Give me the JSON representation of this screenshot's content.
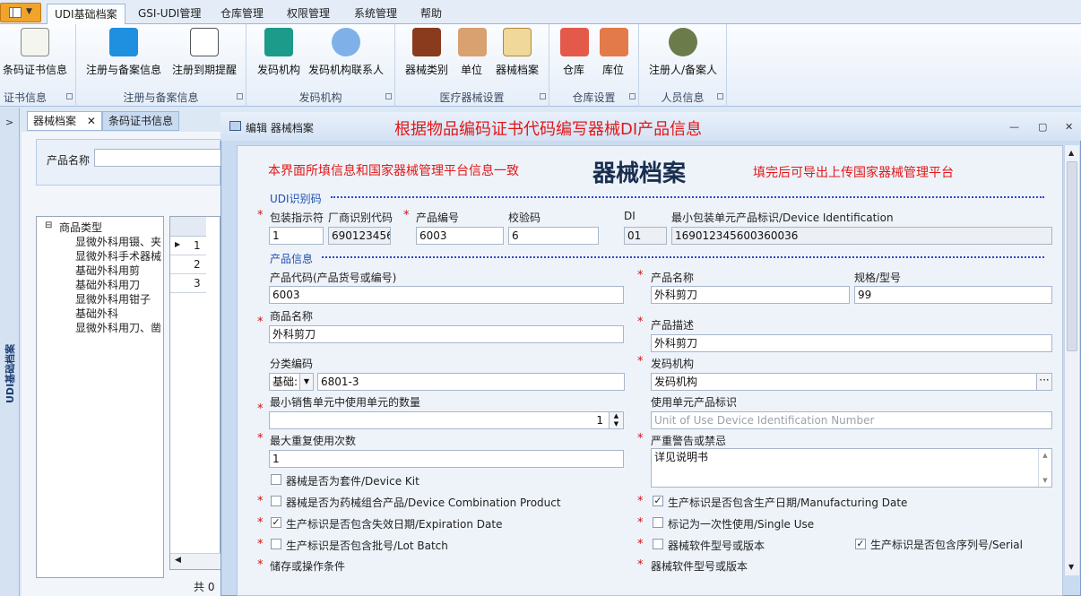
{
  "ribbon_tabs": [
    "UDI基础档案",
    "GSI-UDI管理",
    "仓库管理",
    "权限管理",
    "系统管理",
    "帮助"
  ],
  "ribbon_groups": [
    {
      "label": "证书信息",
      "buttons": [
        "条码证书信息"
      ]
    },
    {
      "label": "注册与备案信息",
      "buttons": [
        "注册与备案信息",
        "注册到期提醒"
      ]
    },
    {
      "label": "发码机构",
      "buttons": [
        "发码机构",
        "发码机构联系人"
      ]
    },
    {
      "label": "医疗器械设置",
      "buttons": [
        "器械类别",
        "单位",
        "器械档案"
      ]
    },
    {
      "label": "仓库设置",
      "buttons": [
        "仓库",
        "库位"
      ]
    },
    {
      "label": "人员信息",
      "buttons": [
        "注册人/备案人"
      ]
    }
  ],
  "side_label": "UDI基础档案",
  "doc_tabs": [
    "器械档案",
    "条码证书信息"
  ],
  "search": {
    "label": "产品名称"
  },
  "tree": {
    "root": "商品类型",
    "items": [
      "显微外科用镊、夹",
      "显微外科手术器械",
      "基础外科用剪",
      "基础外科用刀",
      "显微外科用钳子",
      "基础外科",
      "显微外科用刀、凿"
    ]
  },
  "grid": {
    "rows": [
      "1",
      "2",
      "3"
    ],
    "footer": "共 0"
  },
  "edit_window": {
    "title": "编辑 器械档案",
    "annotation": "根据物品编码证书代码编写器械DI产品信息",
    "form_title": "器械档案",
    "note_left": "本界面所填信息和国家器械管理平台信息一致",
    "note_right": "填完后可导出上传国家器械管理平台",
    "sec_udi": "UDI识别码",
    "sec_product": "产品信息",
    "labels": {
      "pack": "包装指示符",
      "mfr": "厂商识别代码",
      "prodno": "产品编号",
      "check": "校验码",
      "di": "DI",
      "min_unit": "最小包装单元产品标识/Device Identification",
      "prodcode": "产品代码(产品货号或编号)",
      "prodname": "产品名称",
      "spec": "规格/型号",
      "goodsname": "商品名称",
      "desc": "产品描述",
      "catcode": "分类编码",
      "issuer": "发码机构",
      "minsale": "最小销售单元中使用单元的数量",
      "useunit": "使用单元产品标识",
      "maxreuse": "最大重复使用次数",
      "warning": "严重警告或禁忌",
      "kit": "器械是否为套件/Device Kit",
      "combo": "器械是否为药械组合产品/Device Combination Product",
      "mfgdate": "生产标识是否包含生产日期/Manufacturing Date",
      "expdate": "生产标识是否包含失效日期/Expiration Date",
      "single": "标记为一次性使用/Single Use",
      "lot": "生产标识是否包含批号/Lot Batch",
      "sw": "器械软件型号或版本",
      "serial": "生产标识是否包含序列号/Serial",
      "storage": "储存或操作条件",
      "sw2": "器械软件型号或版本"
    },
    "values": {
      "pack": "1",
      "mfr": "690123456",
      "prodno": "6003",
      "check": "6",
      "di": "01",
      "min_unit": "169012345600360036",
      "prodcode": "6003",
      "prodname": "外科剪刀",
      "spec": "99",
      "goodsname": "外科剪刀",
      "desc": "外科剪刀",
      "cat_select": "基础:",
      "catcode": "6801-3",
      "issuer": "发码机构",
      "minsale": "1",
      "useunit_placeholder": "Unit of Use Device Identification Number",
      "maxreuse": "1",
      "warning": "详见说明书"
    },
    "checks": {
      "kit": false,
      "combo": false,
      "mfgdate": true,
      "expdate": true,
      "single": false,
      "lot": false,
      "sw": false,
      "serial": true
    }
  }
}
